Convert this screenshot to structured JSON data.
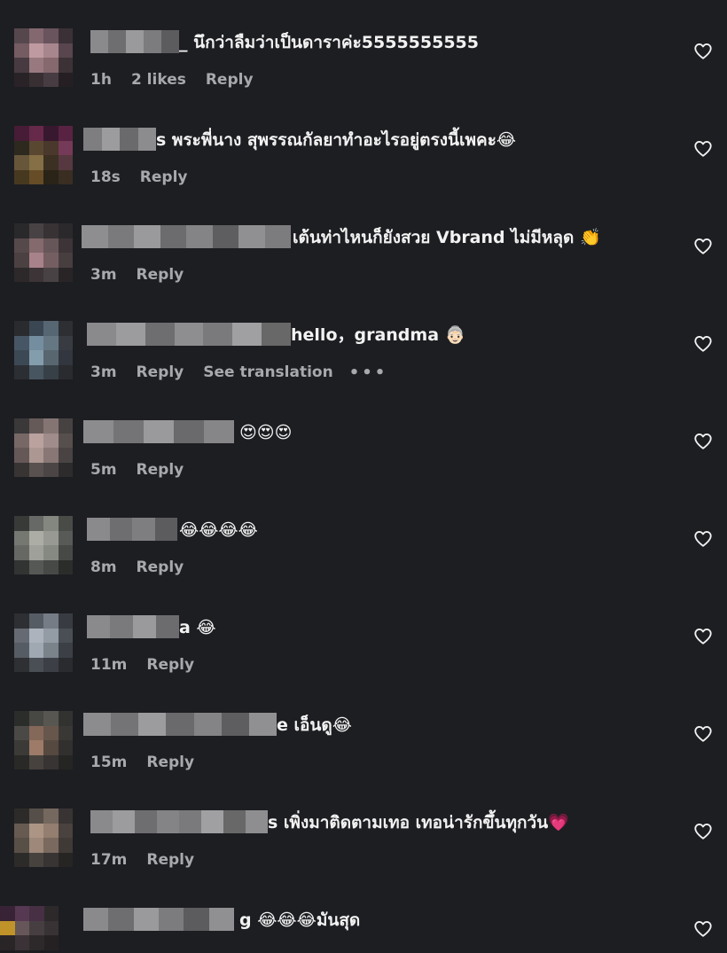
{
  "colors": {
    "background": "#1d1e22",
    "text_primary": "#f2f2f2",
    "text_secondary": "#a8a9ad"
  },
  "comments": [
    {
      "text": "_ นึกว่าลืมว่าเป็นดาราค่ะ5555555555",
      "time": "1h",
      "likes": "2 likes",
      "reply": "Reply",
      "avatar": [
        "#5a4a50",
        "#8a6c74",
        "#6e5660",
        "#3c3238",
        "#7a6066",
        "#c8a2a8",
        "#b08c94",
        "#5c4850",
        "#4a3c42",
        "#a07e86",
        "#8c6c74",
        "#3e3438",
        "#2a2428",
        "#3a3034",
        "#4a3e44",
        "#262024"
      ],
      "name": [
        "#8a8a8c",
        "#6e6e70",
        "#9a9a9c",
        "#7c7c7e",
        "#5c5c5e"
      ]
    },
    {
      "text": "s พระพี่นาง สุพรรณกัลยาทำอะไรอยู่ตรงนี้เพคะ😂",
      "time": "18s",
      "reply": "Reply",
      "avatar": [
        "#4a1c38",
        "#6a2a4c",
        "#3a1830",
        "#5c2444",
        "#2e2a1e",
        "#5e4a32",
        "#4c3a2c",
        "#7a3c5a",
        "#6c5a3c",
        "#8a7448",
        "#3e3224",
        "#5a3a42",
        "#4a3a20",
        "#6a5028",
        "#2a2418",
        "#3c2e22"
      ],
      "name": [
        "#7e7e80",
        "#9c9c9e",
        "#6a6a6c",
        "#8c8c8e"
      ]
    },
    {
      "text": "เต้นท่าไหนก็ยังสวย Vbrand ไม่มีหลุด 👏",
      "time": "3m",
      "reply": "Reply",
      "avatar": [
        "#2a2a2c",
        "#4c4446",
        "#3a3436",
        "#2c2a2c",
        "#5a4c4e",
        "#8a6e72",
        "#6c5a5c",
        "#3e3638",
        "#4e4244",
        "#b08890",
        "#7a6266",
        "#4a4042",
        "#2e2a2c",
        "#3e3638",
        "#4c4446",
        "#2a2628"
      ],
      "name": [
        "#8e8e90",
        "#7a7a7c",
        "#9a9a9c",
        "#6c6c6e",
        "#848486",
        "#5e5e60",
        "#909092",
        "#7c7c7e"
      ]
    },
    {
      "text": "hello，grandma 👵🏻",
      "time": "3m",
      "reply": "Reply",
      "see_translation": "See translation",
      "more": "•••",
      "avatar": [
        "#2a2c30",
        "#3c4a56",
        "#5a6a78",
        "#2e3034",
        "#4a5a68",
        "#7a94a6",
        "#6a7c8a",
        "#3a3e44",
        "#3e4c58",
        "#8aa4b4",
        "#5c6a74",
        "#343840",
        "#2c3034",
        "#4a5864",
        "#3a424a",
        "#2a2c30"
      ],
      "name": [
        "#8a8a8c",
        "#9c9c9e",
        "#6e6e70",
        "#8e8e90",
        "#7a7a7c",
        "#a0a0a2",
        "#686868"
      ]
    },
    {
      "text": "😍😍😍",
      "time": "5m",
      "reply": "Reply",
      "avatar": [
        "#3c3a3a",
        "#6a5e5c",
        "#8a7a78",
        "#4a4444",
        "#7c6c6a",
        "#c4aaa6",
        "#a89290",
        "#5a5250",
        "#6a5c5a",
        "#b49e9a",
        "#8e7c7a",
        "#4c4646",
        "#3a3636",
        "#5c5452",
        "#4e4848",
        "#2e2c2c"
      ],
      "name": [
        "#8c8c8e",
        "#747476",
        "#9a9a9c",
        "#6a6a6c",
        "#868688"
      ]
    },
    {
      "text": "😂😂😂😂",
      "time": "8m",
      "reply": "Reply",
      "avatar": [
        "#3a3c3a",
        "#6c6e6a",
        "#8a8c86",
        "#4c4e4a",
        "#7a7c76",
        "#b4b6ae",
        "#9ea098",
        "#5c5e5a",
        "#6a6c68",
        "#a6a8a0",
        "#8c8e88",
        "#4a4c48",
        "#343634",
        "#5a5c58",
        "#4a4c4a",
        "#2c2e2c"
      ],
      "name": [
        "#8a8a8c",
        "#6e6e70",
        "#7e7e80",
        "#5c5c5e"
      ]
    },
    {
      "text": "a 😂",
      "time": "11m",
      "reply": "Reply",
      "avatar": [
        "#2e3034",
        "#5a6068",
        "#7a828c",
        "#3a3e44",
        "#6a7078",
        "#b4bcc6",
        "#9aa2ac",
        "#4c5258",
        "#5a6068",
        "#a8b0ba",
        "#808890",
        "#3e4248",
        "#303236",
        "#4c5258",
        "#3e4248",
        "#2a2c30"
      ],
      "name": [
        "#8a8a8c",
        "#7a7a7c",
        "#9a9a9c",
        "#6c6c6e"
      ]
    },
    {
      "text": "e เอ็นดู😂",
      "time": "15m",
      "reply": "Reply",
      "avatar": [
        "#2c2e2c",
        "#4a4a46",
        "#5c5a54",
        "#343432",
        "#4e4c48",
        "#8a6c5e",
        "#6c5a4e",
        "#3c3a36",
        "#3e3c38",
        "#a4806c",
        "#5a4c42",
        "#343230",
        "#2a2a28",
        "#4a4440",
        "#3a3634",
        "#262624"
      ],
      "name": [
        "#8c8c8e",
        "#747476",
        "#9c9c9e",
        "#6a6a6c",
        "#848486",
        "#5e5e60",
        "#909092"
      ]
    },
    {
      "text": "s เพิ่งมาติดตามเทอ เทอน่ารักขึ้นทุกวัน💗",
      "time": "17m",
      "reply": "Reply",
      "avatar": [
        "#2e2c2a",
        "#5a524c",
        "#7a6c62",
        "#3a3634",
        "#6a5e54",
        "#b49c8a",
        "#9a8474",
        "#4c4440",
        "#5c524a",
        "#a48e7e",
        "#806e62",
        "#423c38",
        "#2e2c2a",
        "#4a4440",
        "#3a3634",
        "#282624"
      ],
      "name": [
        "#8a8a8c",
        "#9c9c9e",
        "#6e6e70",
        "#848486",
        "#7a7a7c",
        "#a0a0a2",
        "#686868",
        "#8e8e90"
      ]
    },
    {
      "text": "g 😂😂😂มันสุด",
      "avatar": [
        "#3a2438",
        "#5a3a56",
        "#4a3046",
        "#2e2a2c",
        "#c89a2a",
        "#6a5a5e",
        "#4a4044",
        "#3a3436",
        "#2a2628",
        "#3c3438",
        "#2e2a2c",
        "#262224",
        "#1e1c1e",
        "#201e20",
        "#1e1c1e",
        "#1d1e22"
      ],
      "name": [
        "#8a8a8c",
        "#6e6e70",
        "#9a9a9c",
        "#7c7c7e",
        "#5c5c5e",
        "#909092"
      ]
    }
  ]
}
